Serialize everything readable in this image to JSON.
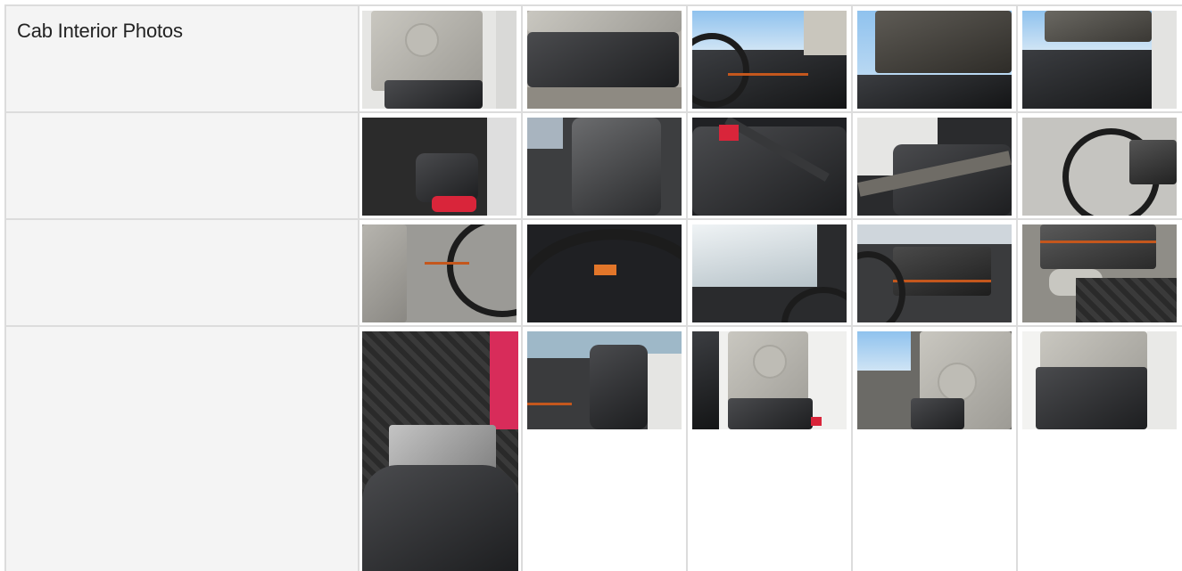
{
  "section": {
    "title": "Cab Interior Photos"
  },
  "photos": [
    {
      "icon": "door-panel-photo"
    },
    {
      "icon": "door-panel-photo"
    },
    {
      "icon": "dashboard-photo"
    },
    {
      "icon": "cab-ceiling-photo"
    },
    {
      "icon": "cab-ceiling-photo"
    },
    {
      "icon": "driver-seat-photo"
    },
    {
      "icon": "passenger-seat-photo"
    },
    {
      "icon": "seat-belt-photo"
    },
    {
      "icon": "seat-belt-photo"
    },
    {
      "icon": "steering-wheel-photo"
    },
    {
      "icon": "door-steering-photo"
    },
    {
      "icon": "instrument-cluster-photo"
    },
    {
      "icon": "windshield-photo"
    },
    {
      "icon": "center-console-photo"
    },
    {
      "icon": "cup-holder-photo"
    },
    {
      "icon": "floor-mat-shifter-photo"
    },
    {
      "icon": "sleeper-seat-photo"
    },
    {
      "icon": "door-panel-photo"
    },
    {
      "icon": "door-panel-photo"
    },
    {
      "icon": "door-panel-photo"
    }
  ]
}
